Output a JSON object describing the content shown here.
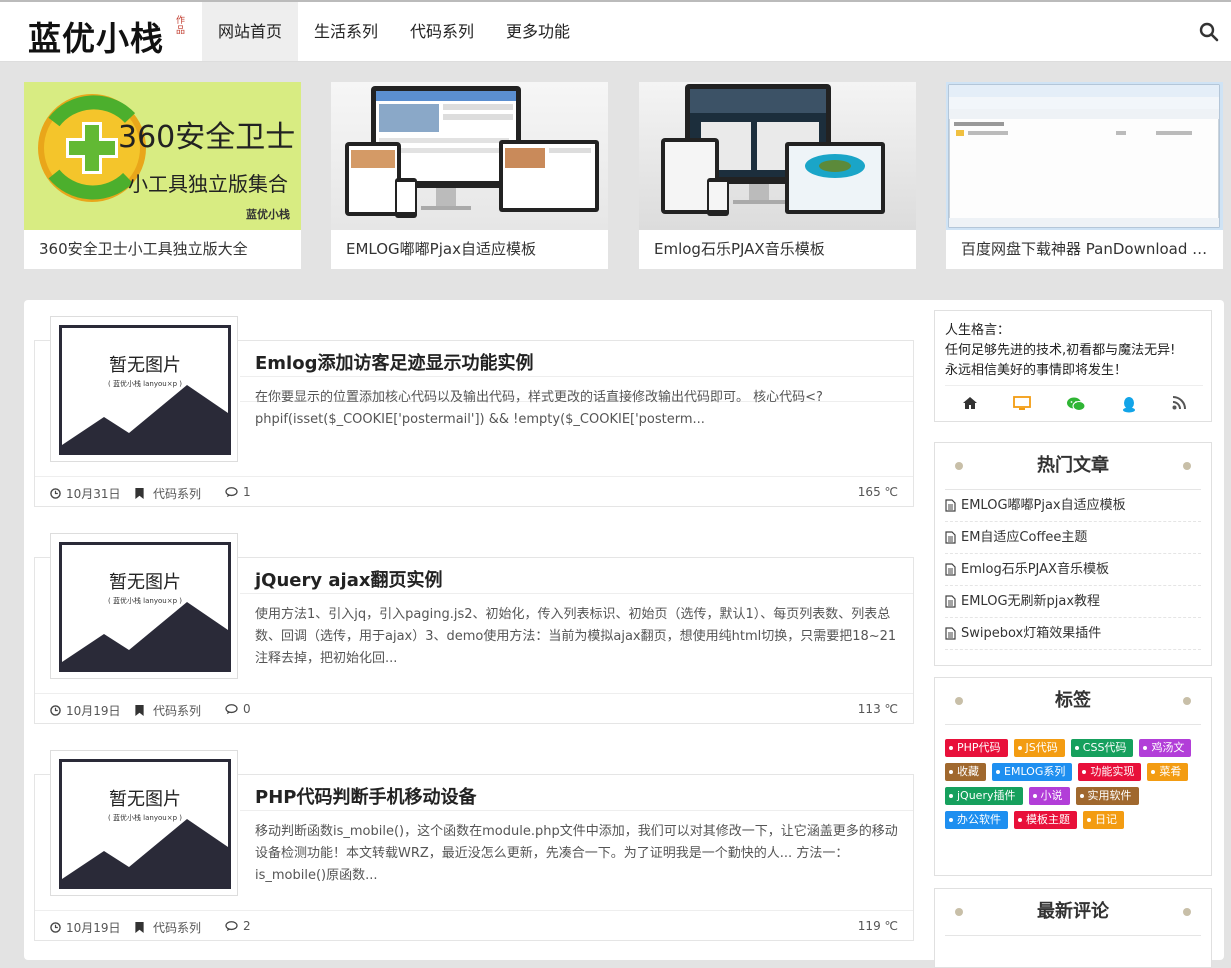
{
  "header": {
    "logo": "蓝优小栈",
    "logo_stamp": "作品",
    "nav": [
      "网站首页",
      "生活系列",
      "代码系列",
      "更多功能"
    ]
  },
  "slides": [
    {
      "caption": "360安全卫士小工具独立版大全",
      "banner_title": "360安全卫士",
      "banner_sub": "小工具独立版集合",
      "banner_mark": "蓝优小栈"
    },
    {
      "caption": "EMLOG嘟嘟Pjax自适应模板"
    },
    {
      "caption": "Emlog石乐PJAX音乐模板"
    },
    {
      "caption": "百度网盘下载神器 PanDownload v..."
    }
  ],
  "placeholder": {
    "title": "暂无图片",
    "sub": "( 蓝优小栈 lanyou×p )"
  },
  "posts": [
    {
      "title": "Emlog添加访客足迹显示功能实例",
      "excerpt": "在你要显示的位置添加核心代码以及输出代码，样式更改的话直接修改输出代码即可。 核心代码<?phpif(isset($_COOKIE['postermail']) && !empty($_COOKIE['posterm...",
      "date": "10月31日",
      "category": "代码系列",
      "comments": "1",
      "temp": "165 ℃"
    },
    {
      "title": "jQuery ajax翻页实例",
      "excerpt": "使用方法1、引入jq，引入paging.js2、初始化，传入列表标识、初始页（选传，默认1）、每页列表数、列表总数、回调（选传，用于ajax）3、demo使用方法：当前为模拟ajax翻页，想使用纯html切换，只需要把18~21注释去掉，把初始化回...",
      "date": "10月19日",
      "category": "代码系列",
      "comments": "0",
      "temp": "113 ℃"
    },
    {
      "title": "PHP代码判断手机移动设备",
      "excerpt": "移动判断函数is_mobile()，这个函数在module.php文件中添加，我们可以对其修改一下，让它涵盖更多的移动设备检测功能！本文转载WRZ，最近没怎么更新，先凑合一下。为了证明我是一个勤快的人... 方法一：is_mobile()原函数...",
      "date": "10月19日",
      "category": "代码系列",
      "comments": "2",
      "temp": "119 ℃"
    }
  ],
  "motto": {
    "label": "人生格言：",
    "line1": "任何足够先进的技术,初看都与魔法无异!",
    "line2": "永远相信美好的事情即将发生！"
  },
  "hot": {
    "title": "热门文章",
    "items": [
      "EMLOG嘟嘟Pjax自适应模板",
      "EM自适应Coffee主题",
      "Emlog石乐PJAX音乐模板",
      "EMLOG无刷新pjax教程",
      "Swipebox灯箱效果插件"
    ]
  },
  "tags_widget": {
    "title": "标签",
    "tags": [
      {
        "label": "PHP代码",
        "color": "#e8103a"
      },
      {
        "label": "JS代码",
        "color": "#f39c12"
      },
      {
        "label": "CSS代码",
        "color": "#16a05d"
      },
      {
        "label": "鸡汤文",
        "color": "#b23ed8"
      },
      {
        "label": "收藏",
        "color": "#a0682e"
      },
      {
        "label": "EMLOG系列",
        "color": "#1e8ff0"
      },
      {
        "label": "功能实现",
        "color": "#e8103a"
      },
      {
        "label": "菜肴",
        "color": "#f39c12"
      },
      {
        "label": "jQuery插件",
        "color": "#16a05d"
      },
      {
        "label": "小说",
        "color": "#b23ed8"
      },
      {
        "label": "实用软件",
        "color": "#a0682e"
      },
      {
        "label": "办公软件",
        "color": "#1e8ff0"
      },
      {
        "label": "模板主题",
        "color": "#e8103a"
      },
      {
        "label": "日记",
        "color": "#f39c12"
      }
    ]
  },
  "comments_widget": {
    "title": "最新评论"
  }
}
